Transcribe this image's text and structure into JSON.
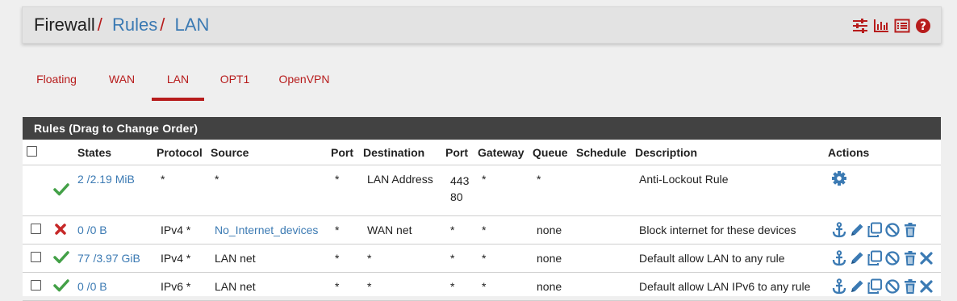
{
  "breadcrumb": {
    "items": [
      "Firewall",
      "Rules",
      "LAN"
    ],
    "separator": "/"
  },
  "header_icons": [
    "sliders-icon",
    "bar-chart-icon",
    "list-icon",
    "help-icon"
  ],
  "tabs": [
    {
      "label": "Floating",
      "active": false
    },
    {
      "label": "WAN",
      "active": false
    },
    {
      "label": "LAN",
      "active": true
    },
    {
      "label": "OPT1",
      "active": false
    },
    {
      "label": "OpenVPN",
      "active": false
    }
  ],
  "panel": {
    "title": "Rules (Drag to Change Order)"
  },
  "columns": [
    "",
    "",
    "States",
    "Protocol",
    "Source",
    "Port",
    "Destination",
    "Port",
    "Gateway",
    "Queue",
    "Schedule",
    "Description",
    "Actions"
  ],
  "rows": [
    {
      "status": "pass",
      "states": "2 /2.19 MiB",
      "protocol": "*",
      "source": "*",
      "source_port": "*",
      "destination": "LAN Address",
      "dest_port": "443",
      "dest_port2": "80",
      "gateway": "*",
      "queue": "*",
      "schedule": "",
      "description": "Anti-Lockout Rule",
      "actions": [
        "gear-icon"
      ]
    },
    {
      "status": "block",
      "states": "0 /0 B",
      "protocol": "IPv4 *",
      "source": "No_Internet_devices",
      "source_port": "*",
      "destination": "WAN net",
      "dest_port": "*",
      "gateway": "*",
      "queue": "none",
      "schedule": "",
      "description": "Block internet for these devices",
      "actions": [
        "anchor-icon",
        "pencil-icon",
        "copy-icon",
        "disable-icon",
        "trash-icon"
      ]
    },
    {
      "status": "pass",
      "states": "77 /3.97 GiB",
      "protocol": "IPv4 *",
      "source": "LAN net",
      "source_port": "*",
      "destination": "*",
      "dest_port": "*",
      "gateway": "*",
      "queue": "none",
      "schedule": "",
      "description": "Default allow LAN to any rule",
      "actions": [
        "anchor-icon",
        "pencil-icon",
        "copy-icon",
        "disable-icon",
        "trash-icon",
        "delete-x-icon"
      ]
    },
    {
      "status": "pass",
      "states": "0 /0 B",
      "protocol": "IPv6 *",
      "source": "LAN net",
      "source_port": "*",
      "destination": "*",
      "dest_port": "*",
      "gateway": "*",
      "queue": "none",
      "schedule": "",
      "description": "Default allow LAN IPv6 to any rule",
      "actions": [
        "anchor-icon",
        "pencil-icon",
        "copy-icon",
        "disable-icon",
        "trash-icon",
        "delete-x-icon"
      ]
    }
  ],
  "colors": {
    "accent": "#b71c1c",
    "link": "#3b7ab3",
    "pass": "#43a047",
    "block": "#c62828",
    "panel_header": "#424242"
  }
}
